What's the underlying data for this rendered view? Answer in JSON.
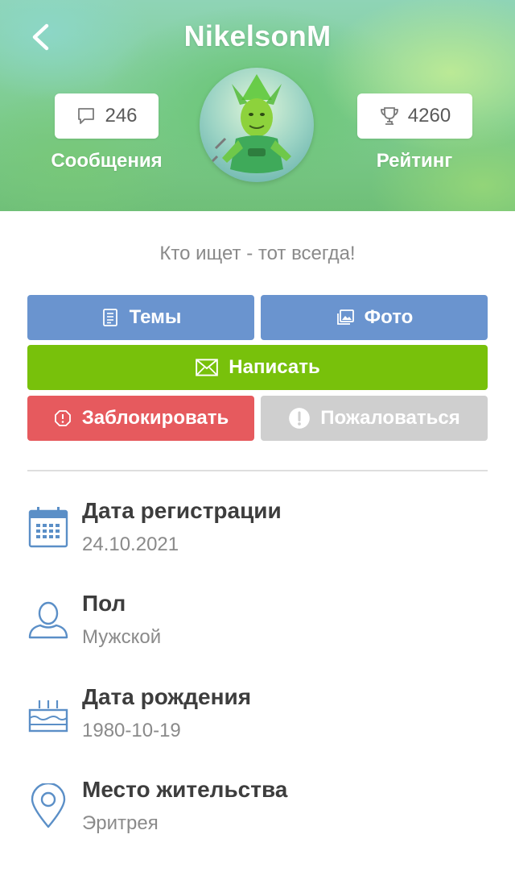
{
  "header": {
    "username": "NikelsonM",
    "stats": {
      "messages": {
        "count": "246",
        "label": "Сообщения",
        "icon": "message-bubble-icon"
      },
      "rating": {
        "count": "4260",
        "label": "Рейтинг",
        "icon": "trophy-icon"
      }
    }
  },
  "status": "Кто ищет - тот всегда!",
  "actions": {
    "topics": "Темы",
    "photo": "Фото",
    "write": "Написать",
    "block": "Заблокировать",
    "report": "Пожаловаться"
  },
  "info": [
    {
      "label": "Дата регистрации",
      "value": "24.10.2021",
      "icon": "calendar-icon"
    },
    {
      "label": "Пол",
      "value": "Мужской",
      "icon": "person-icon"
    },
    {
      "label": "Дата рождения",
      "value": "1980-10-19",
      "icon": "birthday-cake-icon"
    },
    {
      "label": "Место жительства",
      "value": "Эритрея",
      "icon": "location-pin-icon"
    }
  ],
  "colors": {
    "blue_button": "#6a94cf",
    "green_button": "#78c10b",
    "red_button": "#e65a5e",
    "grey_button": "#cfcfcf",
    "icon_blue": "#5b8fc7"
  }
}
